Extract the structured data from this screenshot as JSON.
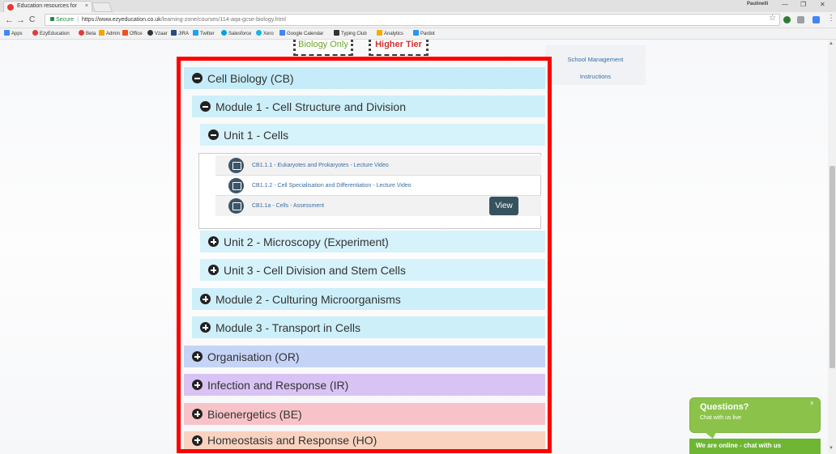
{
  "browser": {
    "tab_title": "Education resources for",
    "tab_close": "×",
    "profile": "Paulinelli",
    "window_controls": [
      "—",
      "❐",
      "✕"
    ],
    "nav": {
      "back": "←",
      "forward": "→",
      "reload": "C"
    },
    "secure_label": "Secure",
    "url_host": "https://www.ezyeducation.co.uk",
    "url_path": "/learning-zone/courses/114-aqa-gcse-biology.html",
    "star": "☆",
    "menu": "⋮",
    "bookmarks": [
      "Apps",
      "EzyEducation",
      "Beta",
      "Admin",
      "Office",
      "Vzaar",
      "JIRA",
      "Twitter",
      "Salesforce",
      "Xero",
      "Google Calendar",
      "Typing Club",
      "Analytics",
      "Pardot"
    ]
  },
  "badges": {
    "biology_only": "Biology Only",
    "higher_tier": "Higher Tier"
  },
  "side_panel": {
    "school_management": "School Management",
    "instructions": "Instructions"
  },
  "accordion": {
    "cell_biology": "Cell Biology (CB)",
    "module1": "Module 1 - Cell Structure and Division",
    "unit1": "Unit 1 - Cells",
    "lessons": [
      "CB1.1.1 - Eukaryotes and Prokaryotes - Lecture Video",
      "CB1.1.2 - Cell Specialisation and Differentiation - Lecture Video",
      "CB1.1a - Cells - Assessment"
    ],
    "view_label": "View",
    "unit2": "Unit 2 - Microscopy (Experiment)",
    "unit3": "Unit 3 - Cell Division and Stem Cells",
    "module2": "Module 2 - Culturing Microorganisms",
    "module3": "Module 3 - Transport in Cells",
    "organisation": "Organisation (OR)",
    "infection": "Infection and Response (IR)",
    "bioenergetics": "Bioenergetics (BE)",
    "homeostasis": "Homeostasis and Response (HO)"
  },
  "colors": {
    "topic_blue": "#c5ecf8",
    "module_blue": "#cdeff9",
    "unit_blue": "#d6f2fb",
    "organisation": "#c5d3f7",
    "infection": "#d9c3f5",
    "bioenergetics": "#f8c3c8",
    "homeostasis": "#f9d3c0"
  },
  "chat": {
    "title": "Questions?",
    "subtitle": "Chat with us live",
    "close": "x",
    "online": "We are online - chat with us"
  }
}
